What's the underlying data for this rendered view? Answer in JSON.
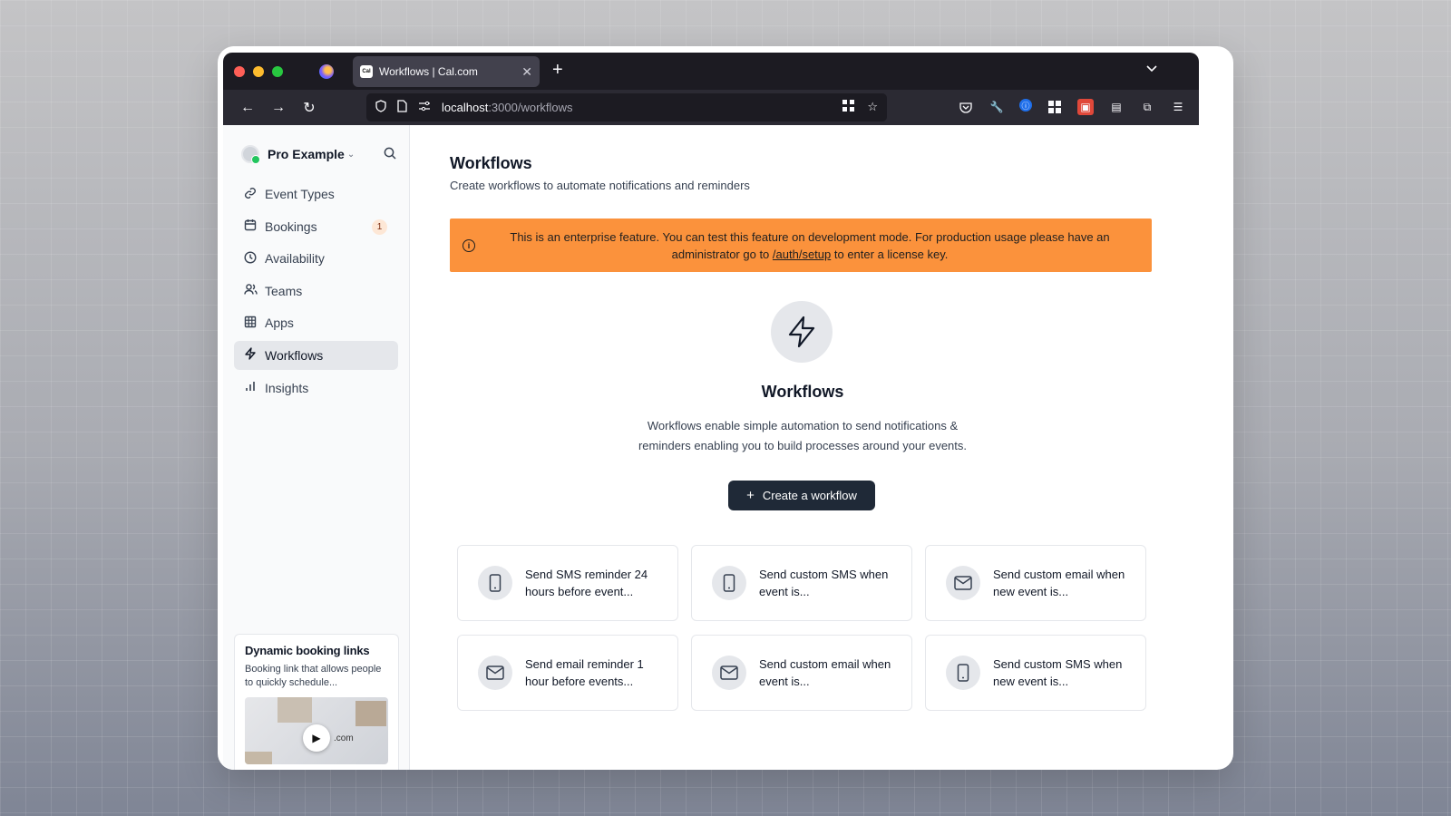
{
  "browser": {
    "tab_title": "Workflows | Cal.com",
    "tab_favicon": "Cal",
    "url_host": "localhost",
    "url_path": ":3000/workflows"
  },
  "sidebar": {
    "profile_name": "Pro Example",
    "items": [
      {
        "label": "Event Types",
        "icon": "link-icon"
      },
      {
        "label": "Bookings",
        "icon": "calendar-icon",
        "badge": "1"
      },
      {
        "label": "Availability",
        "icon": "clock-icon"
      },
      {
        "label": "Teams",
        "icon": "users-icon"
      },
      {
        "label": "Apps",
        "icon": "grid-icon"
      },
      {
        "label": "Workflows",
        "icon": "zap-icon",
        "active": true
      },
      {
        "label": "Insights",
        "icon": "bar-chart-icon"
      }
    ],
    "promo": {
      "title": "Dynamic booking links",
      "description": "Booking link that allows people to quickly schedule...",
      "video_text": ".com"
    }
  },
  "main": {
    "title": "Workflows",
    "subtitle": "Create workflows to automate notifications and reminders",
    "banner": {
      "text_before": "This is an enterprise feature. You can test this feature on development mode. For production usage please have an administrator go to",
      "link": "/auth/setup",
      "text_after": "to enter a license key.",
      "color": "#fb923c"
    },
    "empty_state": {
      "title": "Workflows",
      "description": "Workflows enable simple automation to send notifications & reminders enabling you to build processes around your events."
    },
    "create_button": "Create a workflow",
    "templates": [
      {
        "label": "Send SMS reminder 24 hours before event...",
        "icon": "phone-icon"
      },
      {
        "label": "Send custom SMS when event is...",
        "icon": "phone-icon"
      },
      {
        "label": "Send custom email when new event is...",
        "icon": "mail-icon"
      },
      {
        "label": "Send email reminder 1 hour before events...",
        "icon": "mail-icon"
      },
      {
        "label": "Send custom email when event is...",
        "icon": "mail-icon"
      },
      {
        "label": "Send custom SMS when new event is...",
        "icon": "phone-icon"
      }
    ]
  }
}
